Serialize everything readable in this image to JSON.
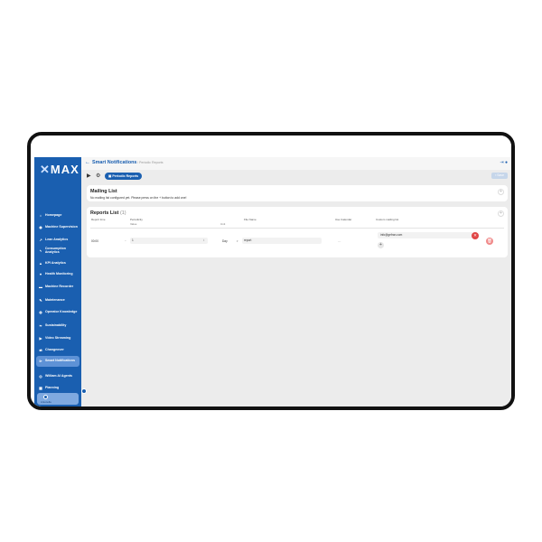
{
  "app": {
    "logo": "MAX"
  },
  "sidebar": {
    "items": [
      {
        "label": "Homepage",
        "icon": "home-icon"
      },
      {
        "label": "Machine Supervision",
        "icon": "eye-icon"
      },
      {
        "label": "Lean Analytics",
        "icon": "trend-icon"
      },
      {
        "label": "Consumption Analytics",
        "icon": "bolt-icon"
      },
      {
        "label": "KPI Analytics",
        "icon": "chart-icon"
      },
      {
        "label": "Health Monitoring",
        "icon": "heart-icon"
      },
      {
        "label": "Machine Recorder",
        "icon": "recorder-icon"
      },
      {
        "label": "Maintenance",
        "icon": "wrench-icon"
      },
      {
        "label": "Operator Knowledge",
        "icon": "bulb-icon"
      },
      {
        "label": "Sustainability",
        "icon": "leaf-icon"
      },
      {
        "label": "Video Streaming",
        "icon": "play-icon"
      },
      {
        "label": "Changeover",
        "icon": "swap-icon"
      },
      {
        "label": "Smart Notifications",
        "icon": "bell-icon",
        "active": true
      },
      {
        "label": "Wiiliam AI Agents",
        "icon": "bot-icon"
      },
      {
        "label": "Planning",
        "icon": "calendar-icon"
      }
    ],
    "user_name": "Antonella"
  },
  "header": {
    "title": "Smart Notifications",
    "subtitle": "/ Periodic Reports"
  },
  "toolbar": {
    "chip_label": "Periodic Reports",
    "save_label": "Save"
  },
  "mailing": {
    "title": "Mailing List",
    "empty_message": "No mailing list configured yet. Please press on the + button to add one!"
  },
  "reports": {
    "title": "Reports List",
    "count": "(1)",
    "columns": {
      "report_time": "Report time",
      "periodicity": "Periodicity",
      "periodicity_value": "Value",
      "periodicity_unit": "Unit",
      "file_name": "File Name",
      "use_calendar": "Use Calendar",
      "custom_mailing": "Custom mailing list"
    },
    "rows": [
      {
        "time": "00:00",
        "value": "1",
        "unit": "Day",
        "file_name": "report",
        "use_calendar": "—",
        "email": "info@gefran.com"
      }
    ]
  }
}
